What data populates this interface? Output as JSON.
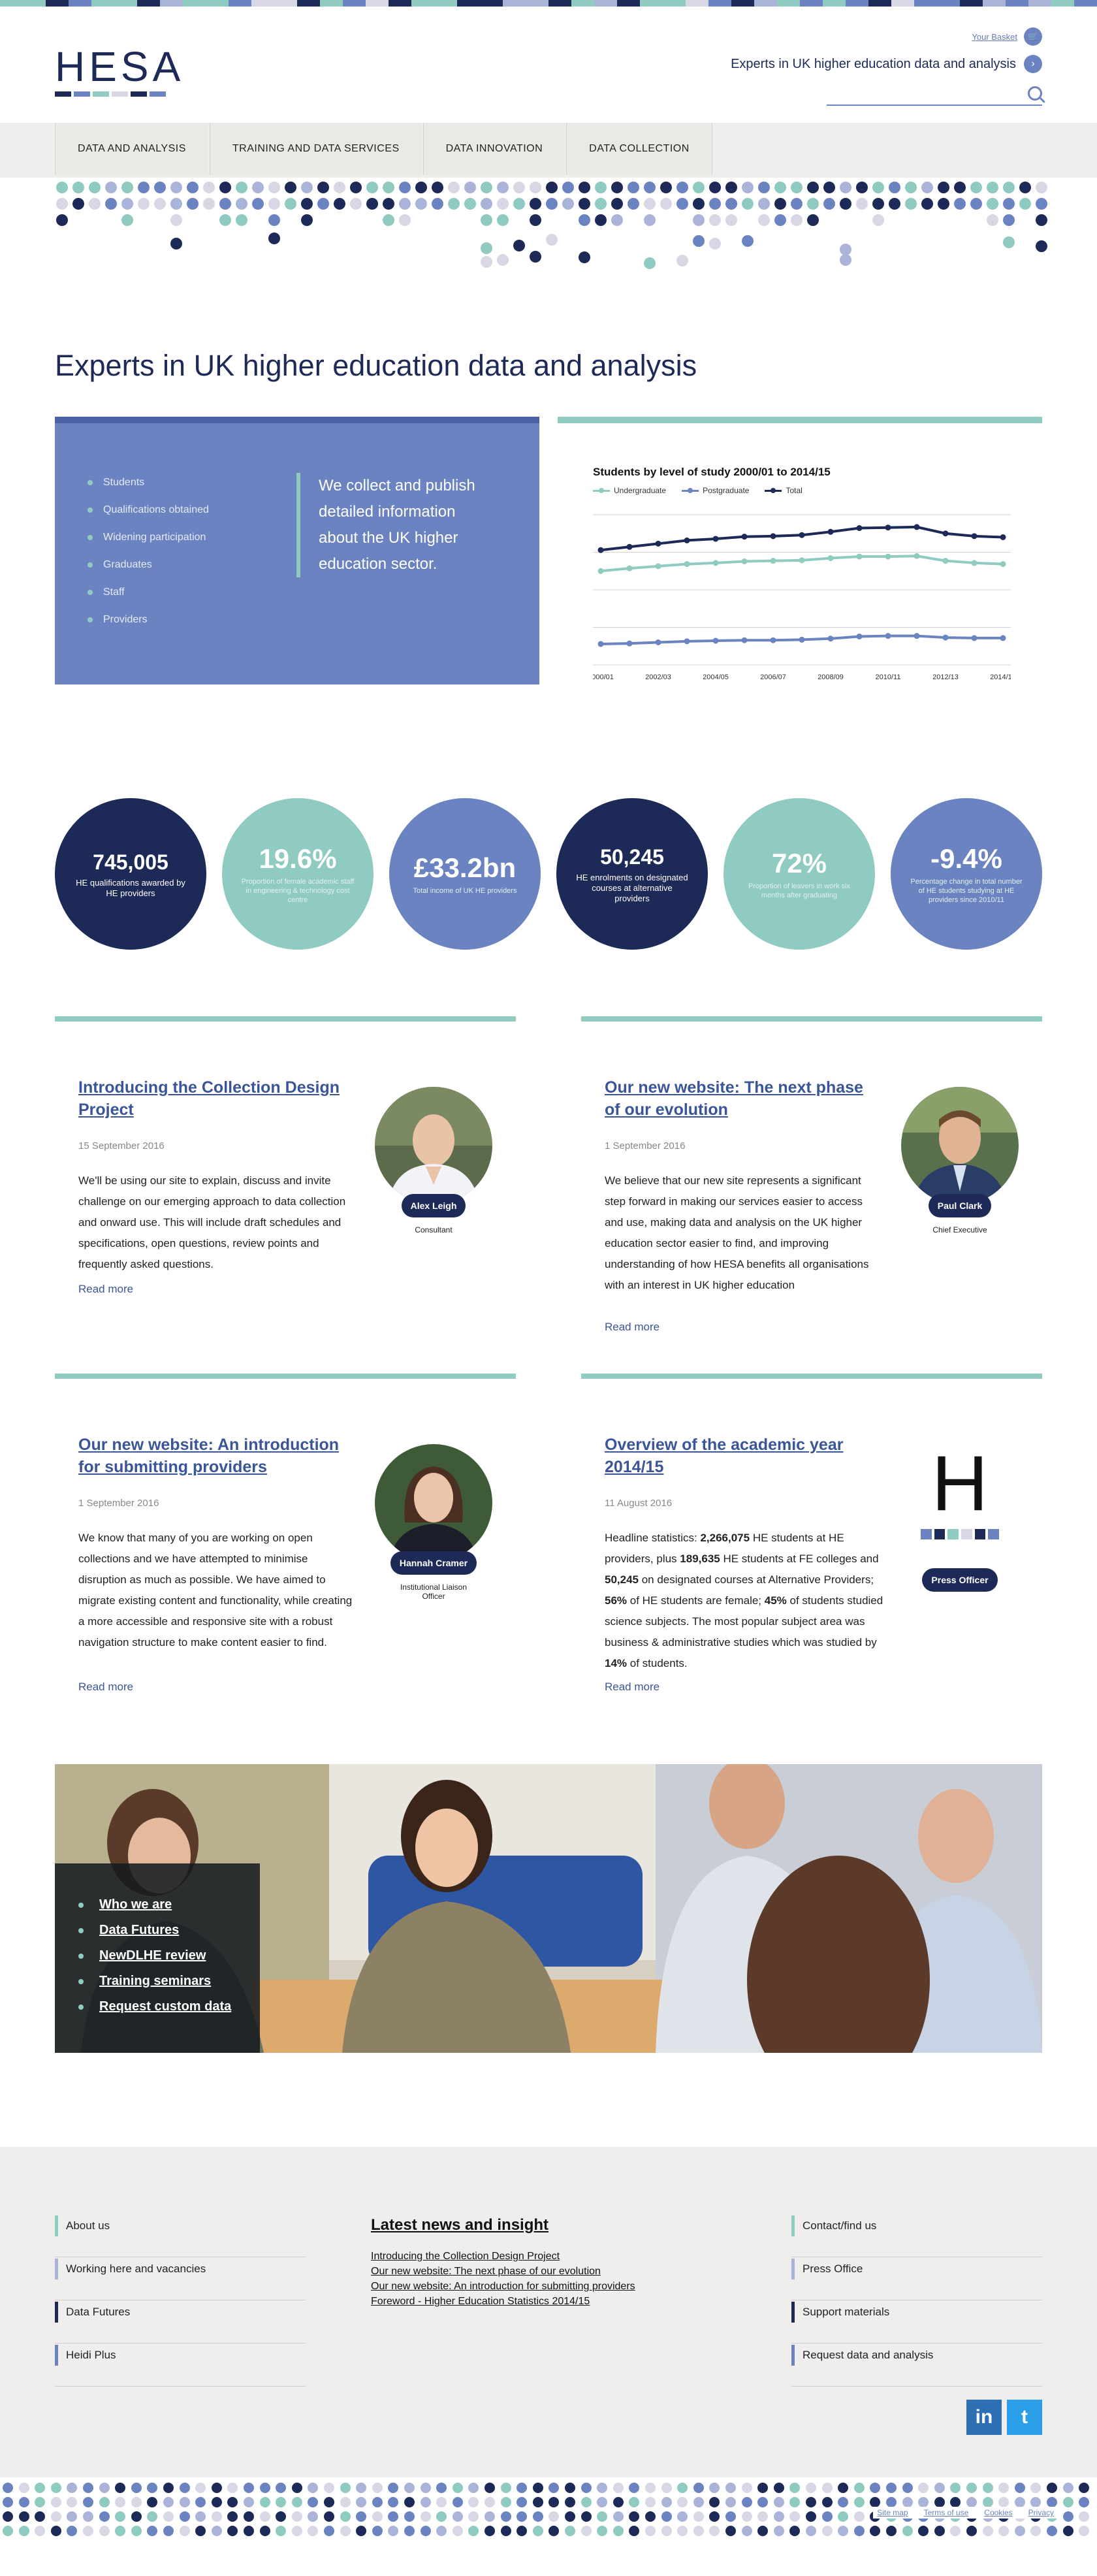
{
  "colors": {
    "navy": "#1d2a57",
    "blue": "#6b83c0",
    "teal": "#8fcbc0",
    "grey": "#efeeec"
  },
  "header": {
    "logo_text": "HESA",
    "basket_label": "Your Basket",
    "basket_icon": "cart-icon",
    "tagline": "Experts in UK higher education data and analysis",
    "tagline_icon": "chevron-right-icon",
    "search_placeholder": "",
    "search_icon": "search-icon"
  },
  "nav": {
    "items": [
      "DATA AND ANALYSIS",
      "TRAINING AND DATA SERVICES",
      "DATA INNOVATION",
      "DATA COLLECTION"
    ]
  },
  "page_title": "Experts in UK higher education data and analysis",
  "panel": {
    "links": [
      "Students",
      "Qualifications obtained",
      "Widening participation",
      "Graduates",
      "Staff",
      "Providers"
    ],
    "lead": "We collect and publish detailed information about the UK higher education sector."
  },
  "chart_data": {
    "type": "line",
    "title": "Students by level of study 2000/01 to 2014/15",
    "xlabel": "",
    "ylabel": "",
    "categories": [
      "2000/01",
      "2001/02",
      "2002/03",
      "2003/04",
      "2004/05",
      "2005/06",
      "2006/07",
      "2007/08",
      "2008/09",
      "2009/10",
      "2010/11",
      "2011/12",
      "2012/13",
      "2013/14",
      "2014/15"
    ],
    "tick_labels": [
      "2000/01",
      "2002/03",
      "2004/05",
      "2006/07",
      "2008/09",
      "2010/11",
      "2012/13",
      "2014/15"
    ],
    "ylim": [
      0,
      2800000
    ],
    "grid": true,
    "legend": "top-left",
    "series": [
      {
        "name": "Undergraduate",
        "color": "#8fcbc0",
        "values": [
          1750000,
          1800000,
          1840000,
          1880000,
          1900000,
          1930000,
          1940000,
          1950000,
          1990000,
          2020000,
          2020000,
          2030000,
          1940000,
          1900000,
          1880000
        ]
      },
      {
        "name": "Postgraduate",
        "color": "#6b83c0",
        "values": [
          390000,
          400000,
          420000,
          440000,
          450000,
          460000,
          460000,
          470000,
          490000,
          530000,
          540000,
          540000,
          510000,
          500000,
          500000
        ]
      },
      {
        "name": "Total",
        "color": "#1d2a57",
        "values": [
          2140000,
          2200000,
          2260000,
          2320000,
          2350000,
          2390000,
          2400000,
          2420000,
          2480000,
          2550000,
          2560000,
          2570000,
          2450000,
          2400000,
          2380000
        ]
      }
    ]
  },
  "stats": [
    {
      "value": "745,005",
      "label": "HE qualifications awarded by HE providers",
      "color": "#1d2a57"
    },
    {
      "value": "19.6%",
      "label": "Proportion of female academic staff in engineering & technology cost centre",
      "color": "#8fcbc0"
    },
    {
      "value": "£33.2bn",
      "label": "Total income of UK HE providers",
      "color": "#6b83c0"
    },
    {
      "value": "50,245",
      "label": "HE enrolments on designated courses at alternative providers",
      "color": "#1d2a57"
    },
    {
      "value": "72%",
      "label": "Proportion of leavers in work six months after graduating",
      "color": "#8fcbc0"
    },
    {
      "value": "-9.4%",
      "label": "Percentage change in total number of HE students studying at HE providers since 2010/11",
      "color": "#6b83c0"
    }
  ],
  "articles": [
    {
      "title": "Introducing the Collection Design Project",
      "date": "15 September 2016",
      "body": "We'll be using our site to explain, discuss and invite challenge on our emerging approach to data collection and onward use. This will include draft schedules and specifications, open questions, review points and frequently asked questions.",
      "more": "Read more",
      "person": "Alex Leigh",
      "role": "Consultant"
    },
    {
      "title": "Our new website: The next phase of our evolution",
      "date": "1 September 2016",
      "body": "We believe that our new site represents a significant step forward in making our services easier to access and use, making data and analysis on the UK higher education sector easier to find, and improving understanding of how HESA benefits all organisations with an interest in UK higher education",
      "more": "Read more",
      "person": "Paul Clark",
      "role": "Chief Executive"
    },
    {
      "title": "Our new website: An introduction for submitting providers",
      "date": "1 September 2016",
      "body": "We know that many of you are working on open collections and we have attempted to minimise disruption as much as possible. We have aimed to migrate existing content and functionality, while creating a more accessible and responsive site with a robust navigation structure to make content easier to find.",
      "more": "Read more",
      "person": "Hannah Cramer",
      "role": "Institutional Liaison Officer"
    },
    {
      "title": "Overview of the academic year 2014/15",
      "date": "11 August 2016",
      "body_parts": [
        "Headline statistics: ",
        "2,266,075",
        " HE students at HE providers, plus ",
        "189,635",
        " HE students at FE colleges and ",
        "50,245",
        " on designated courses at Alternative Providers; ",
        "56%",
        " of HE students are female; ",
        "45%",
        " of students studied science subjects. The most popular subject area was business & administrative studies which was studied by ",
        "14%",
        " of students."
      ],
      "more": "Read more",
      "logo_letter": "H",
      "person": "Press Officer"
    }
  ],
  "hero": {
    "links": [
      "Who we are",
      "Data Futures",
      "NewDLHE review",
      "Training seminars",
      "Request custom data"
    ]
  },
  "footer": {
    "left_links": [
      "About us",
      "Working here and vacancies",
      "Data Futures",
      "Heidi Plus"
    ],
    "news_title": "Latest news and insight",
    "news_links": [
      "Introducing the Collection Design Project",
      "Our new website: The next phase of our evolution",
      "Our new website: An introduction for submitting providers",
      "Foreword - Higher Education Statistics 2014/15"
    ],
    "right_links": [
      "Contact/find us",
      "Press Office",
      "Support materials",
      "Request data and analysis"
    ],
    "social": [
      {
        "icon": "linkedin-icon",
        "glyph": "in",
        "color": "#2c6fb3"
      },
      {
        "icon": "twitter-icon",
        "glyph": "t",
        "color": "#2a9ee6"
      }
    ],
    "legal": [
      "Site map",
      "Terms of use",
      "Cookies",
      "Privacy"
    ]
  }
}
